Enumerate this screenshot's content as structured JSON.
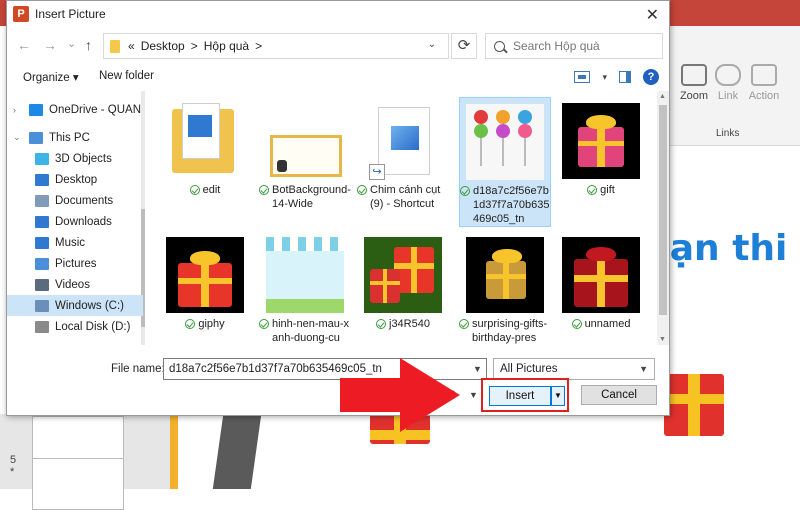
{
  "app": {
    "icon_letter": "P"
  },
  "ribbon": {
    "zoom_label": "Zoom",
    "link_label": "Link",
    "action_label": "Action",
    "group_label": "Links"
  },
  "slide": {
    "title_fragment": "oạn thi"
  },
  "thumbnail_pane": {
    "slide_number": "5",
    "slide_star": "*"
  },
  "dialog": {
    "title": "Insert Picture",
    "close_glyph": "✕",
    "nav": {
      "back": "←",
      "forward": "→",
      "recent": "⌄",
      "up": "↑"
    },
    "address": {
      "root_glyph": "«",
      "segments": [
        "Desktop",
        "Hộp quà"
      ],
      "sep": ">",
      "dropdown": "⌄"
    },
    "refresh_glyph": "⟳",
    "search": {
      "placeholder": "Search Hộp quà"
    },
    "toolbar": {
      "organize": "Organize ▾",
      "new_folder": "New folder",
      "view_caret": "▾",
      "help": "?"
    },
    "nav_pane": [
      {
        "label": "OneDrive - QUAN",
        "icon": "onedrive-icon",
        "color": "#1e88e5"
      },
      {
        "label": "This PC",
        "icon": "pc-icon",
        "color": "#4a8fd8"
      },
      {
        "label": "3D Objects",
        "icon": "cube-icon",
        "color": "#3db3e6"
      },
      {
        "label": "Desktop",
        "icon": "desktop-icon",
        "color": "#2f7ad0"
      },
      {
        "label": "Documents",
        "icon": "documents-icon",
        "color": "#7f9bb8"
      },
      {
        "label": "Downloads",
        "icon": "download-icon",
        "color": "#2f7ad0"
      },
      {
        "label": "Music",
        "icon": "music-icon",
        "color": "#2f7ad0"
      },
      {
        "label": "Pictures",
        "icon": "pictures-icon",
        "color": "#4a8fd8"
      },
      {
        "label": "Videos",
        "icon": "videos-icon",
        "color": "#5a6b7e"
      },
      {
        "label": "Windows (C:)",
        "icon": "drive-icon",
        "color": "#6a8fb8"
      },
      {
        "label": "Local Disk (D:)",
        "icon": "drive-icon",
        "color": "#8a8a8a"
      }
    ],
    "files": [
      {
        "name": "edit",
        "thumb": "folder"
      },
      {
        "name": "BotBackground-14-Wide",
        "thumb": "slide"
      },
      {
        "name": "Chim cánh cụt (9) - Shortcut",
        "thumb": "shortcut"
      },
      {
        "name": "d18a7c2f56e7b1d37f7a70b635469c05_tn",
        "thumb": "lollipops"
      },
      {
        "name": "gift",
        "thumb": "gift-pink"
      },
      {
        "name": "giphy",
        "thumb": "gift-red"
      },
      {
        "name": "hinh-nen-mau-xanh-duong-cu",
        "thumb": "blue-bg"
      },
      {
        "name": "j34R540",
        "thumb": "gifts-green"
      },
      {
        "name": "surprising-gifts-birthday-pres",
        "thumb": "gift-gold"
      },
      {
        "name": "unnamed",
        "thumb": "gift-dark"
      }
    ],
    "file_name_label": "File name:",
    "file_name_value": "d18a7c2f56e7b1d37f7a70b635469c05_tn",
    "file_type": "All Pictures",
    "tools_label": "ls",
    "insert_label": "Insert",
    "cancel_label": "Cancel"
  }
}
